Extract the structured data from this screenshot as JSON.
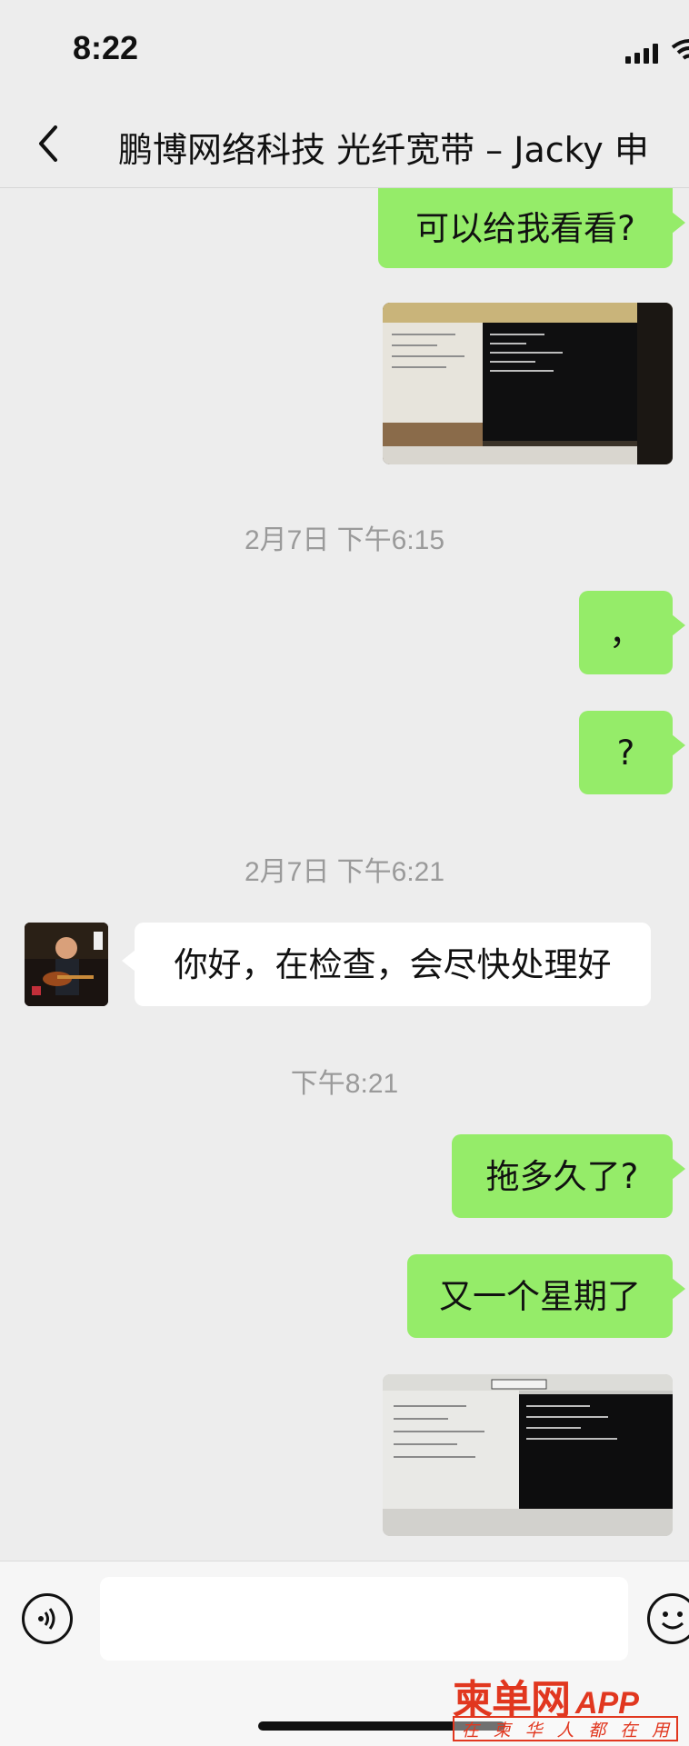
{
  "status_bar": {
    "time": "8:22"
  },
  "header": {
    "title": "鹏博网络科技 光纤宽带 – Jacky 申",
    "back_icon": "chevron-left-icon"
  },
  "messages": [
    {
      "type": "text",
      "from": "me",
      "text": "可以给我看看?"
    },
    {
      "type": "image",
      "from": "me",
      "icon": "screenshot-photo"
    },
    {
      "type": "timestamp",
      "text": "2月7日 下午6:15"
    },
    {
      "type": "text",
      "from": "me",
      "text": "，"
    },
    {
      "type": "text",
      "from": "me",
      "text": "?"
    },
    {
      "type": "timestamp",
      "text": "2月7日 下午6:21"
    },
    {
      "type": "text",
      "from": "other",
      "text": "你好，在检查，会尽快处理好"
    },
    {
      "type": "timestamp",
      "text": "下午8:21"
    },
    {
      "type": "text",
      "from": "me",
      "text": "拖多久了?"
    },
    {
      "type": "text",
      "from": "me",
      "text": "又一个星期了"
    },
    {
      "type": "image",
      "from": "me",
      "icon": "screenshot-photo"
    }
  ],
  "input_bar": {
    "placeholder": "",
    "value": ""
  },
  "watermark": {
    "brand": "柬单网",
    "app": "APP",
    "tagline": [
      "在",
      "柬",
      "华",
      "人",
      "都",
      "在",
      "用"
    ]
  },
  "colors": {
    "my_bubble": "#95ec69",
    "other_bubble": "#ffffff",
    "background": "#ededed",
    "watermark": "#e1371f"
  }
}
